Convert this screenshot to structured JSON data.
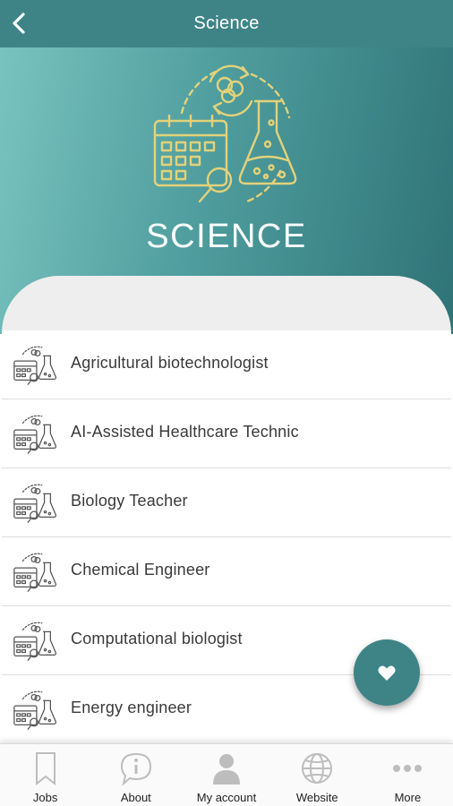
{
  "header": {
    "title": "Science",
    "back_icon": "chevron-left-icon"
  },
  "hero": {
    "title": "SCIENCE",
    "illustration_icon": "science-calendar-flask-icon",
    "gradient_start": "#79c2bf",
    "gradient_end": "#2f7377",
    "icon_color": "#e3d27a"
  },
  "careers": [
    {
      "label": "Agricultural biotechnologist"
    },
    {
      "label": "AI-Assisted Healthcare Technic"
    },
    {
      "label": "Biology Teacher"
    },
    {
      "label": "Chemical Engineer"
    },
    {
      "label": "Computational biologist"
    },
    {
      "label": "Energy engineer"
    }
  ],
  "fab": {
    "icon": "heart-icon",
    "color": "#3e8486"
  },
  "bottom_nav": {
    "items": [
      {
        "label": "Jobs",
        "icon": "bookmark-icon"
      },
      {
        "label": "About",
        "icon": "info-bubble-icon"
      },
      {
        "label": "My account",
        "icon": "user-icon"
      },
      {
        "label": "Website",
        "icon": "globe-icon"
      },
      {
        "label": "More",
        "icon": "more-dots-icon"
      }
    ]
  },
  "colors": {
    "primary": "#3e8486",
    "text": "#3a3a3a",
    "nav_icon": "#bdbdbd"
  }
}
